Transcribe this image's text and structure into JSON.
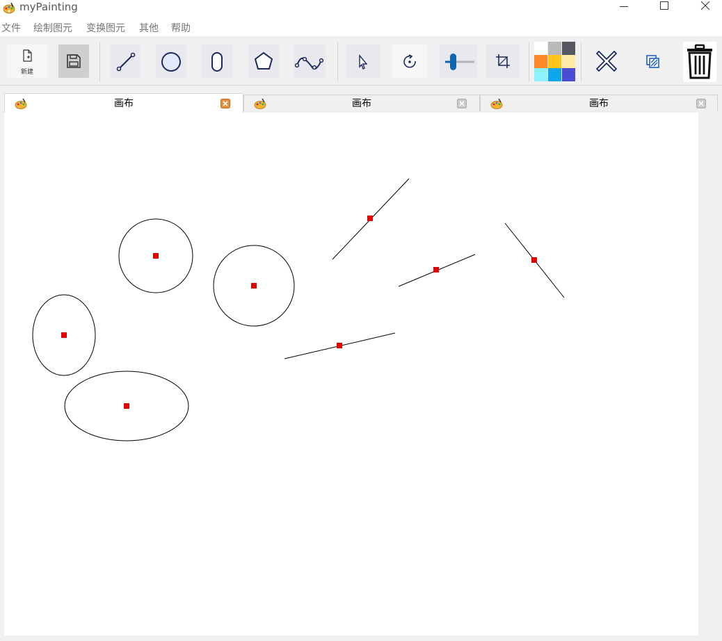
{
  "window": {
    "title": "myPainting",
    "app_icon": "paint-palette-icon",
    "controls": [
      "minimize-icon",
      "maximize-icon",
      "close-icon"
    ]
  },
  "menu": [
    "文件",
    "绘制图元",
    "变换图元",
    "其他",
    "帮助"
  ],
  "toolbar": {
    "new_label": "新建",
    "tools": [
      {
        "id": "new",
        "icon": "new-file-icon"
      },
      {
        "id": "save",
        "icon": "save-icon",
        "active": true
      },
      {
        "id": "line",
        "icon": "line-icon"
      },
      {
        "id": "ellipse",
        "icon": "ellipse-icon"
      },
      {
        "id": "capsule",
        "icon": "rounded-rect-icon"
      },
      {
        "id": "polygon",
        "icon": "pentagon-icon"
      },
      {
        "id": "curve",
        "icon": "curve-icon"
      },
      {
        "id": "select",
        "icon": "cursor-icon"
      },
      {
        "id": "rotate",
        "icon": "rotate-icon"
      },
      {
        "id": "pen-width",
        "icon": "pen-width-slider-icon"
      },
      {
        "id": "clip",
        "icon": "crop-icon"
      },
      {
        "id": "delete",
        "icon": "cross-icon"
      },
      {
        "id": "layers",
        "icon": "layers-icon"
      },
      {
        "id": "clear",
        "icon": "trash-icon"
      }
    ],
    "palette": [
      "#ffffff",
      "#b9b9b9",
      "#57575f",
      "#ff8a2a",
      "#ffc61a",
      "#ffe9a3",
      "#8df2ff",
      "#10a6ec",
      "#4b4bd1"
    ]
  },
  "tabs": [
    {
      "label": "画布",
      "active": true
    },
    {
      "label": "画布",
      "active": false
    },
    {
      "label": "画布",
      "active": false
    }
  ],
  "canvas": {
    "shapes_icon": "drawn-primitives",
    "marker_color": "#e00000"
  }
}
